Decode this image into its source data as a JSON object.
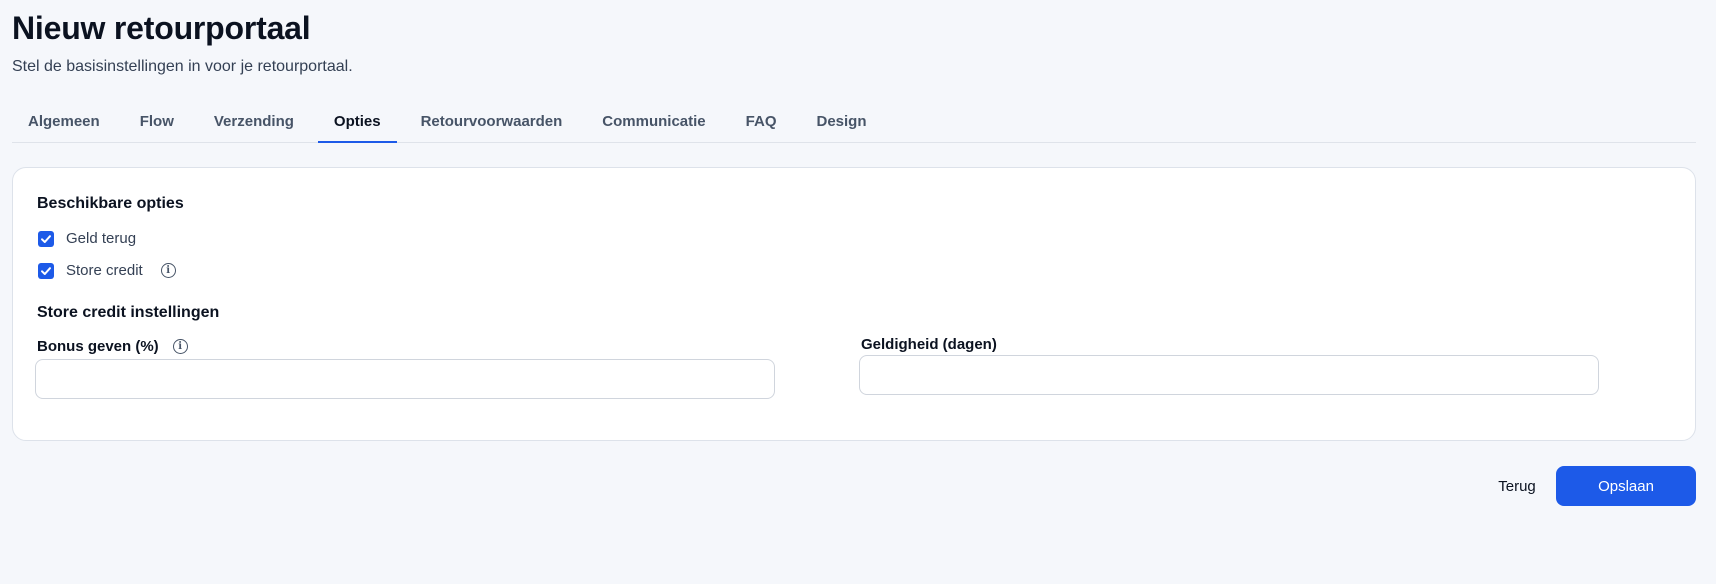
{
  "header": {
    "title": "Nieuw retourportaal",
    "subtitle": "Stel de basisinstellingen in voor je retourportaal."
  },
  "tabs": [
    {
      "label": "Algemeen",
      "active": false
    },
    {
      "label": "Flow",
      "active": false
    },
    {
      "label": "Verzending",
      "active": false
    },
    {
      "label": "Opties",
      "active": true
    },
    {
      "label": "Retourvoorwaarden",
      "active": false
    },
    {
      "label": "Communicatie",
      "active": false
    },
    {
      "label": "FAQ",
      "active": false
    },
    {
      "label": "Design",
      "active": false
    }
  ],
  "options": {
    "title": "Beschikbare opties",
    "items": [
      {
        "label": "Geld terug",
        "checked": true
      },
      {
        "label": "Store credit",
        "checked": true,
        "icon": "info-icon"
      }
    ]
  },
  "store_credit": {
    "title": "Store credit instellingen",
    "bonus": {
      "label": "Bonus geven (%)",
      "value": "",
      "placeholder": "",
      "icon": "info-icon"
    },
    "validity": {
      "label": "Geldigheid (dagen)",
      "value": "",
      "placeholder": ""
    }
  },
  "actions": {
    "back_label": "Terug",
    "save_label": "Opslaan"
  },
  "colors": {
    "accent": "#1d5ae8",
    "background": "#f5f7fb"
  }
}
